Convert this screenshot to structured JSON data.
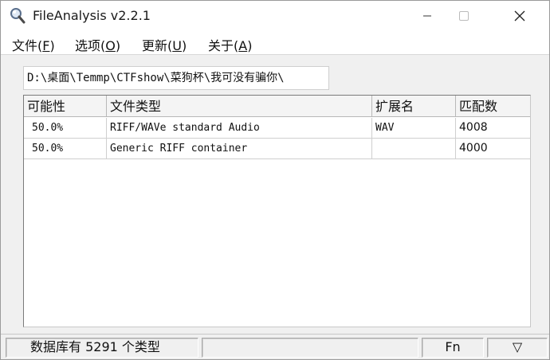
{
  "window": {
    "title": "FileAnalysis v2.2.1",
    "icon": "magnifier-icon"
  },
  "menu": [
    {
      "label": "文件(",
      "accel": "F",
      "tail": ")"
    },
    {
      "label": "选项(",
      "accel": "O",
      "tail": ")"
    },
    {
      "label": "更新(",
      "accel": "U",
      "tail": ")"
    },
    {
      "label": "关于(",
      "accel": "A",
      "tail": ")"
    }
  ],
  "path": "D:\\桌面\\Temmp\\CTFshow\\菜狗杯\\我可没有骗你\\",
  "table": {
    "columns": [
      "可能性",
      "文件类型",
      "扩展名",
      "匹配数"
    ],
    "rows": [
      {
        "probability": "50.0%",
        "type": "RIFF/WAVe standard Audio",
        "ext": "WAV",
        "count": "4008"
      },
      {
        "probability": "50.0%",
        "type": "Generic RIFF container",
        "ext": "",
        "count": "4000"
      }
    ]
  },
  "status": {
    "db_info": "数据库有 5291 个类型",
    "middle": "",
    "fn_label": "Fn",
    "dropdown_glyph": "▽"
  }
}
